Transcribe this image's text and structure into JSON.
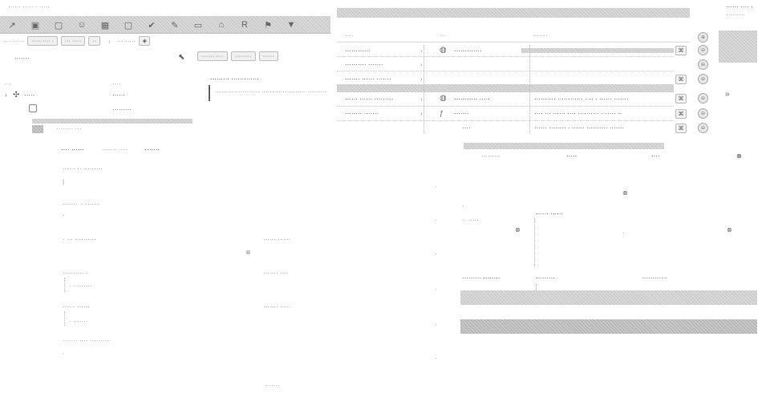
{
  "title_bar": {
    "left_caption": "······ ····· · ·····",
    "right_top": "······ ···· ·",
    "right_top2": "·········"
  },
  "toolbar": {
    "icons": [
      "arrow-icon",
      "image-icon",
      "square-icon",
      "person-icon",
      "grid-icon",
      "square2-icon",
      "check-icon",
      "pen-icon",
      "trash-icon",
      "home-icon",
      "reader-icon",
      "flag-icon",
      "help-icon"
    ]
  },
  "tabs": {
    "items": [
      "·· ·······",
      "·········· ·",
      "··· ·····",
      "··"
    ],
    "right_label": "··· ·····",
    "subtab_label": "······· ····",
    "subtab_2": "·········",
    "subtab_3": "······"
  },
  "left_tree": {
    "header": "·······",
    "col1": "···",
    "col2": "····",
    "rows": [
      {
        "name": "·····",
        "value": "······"
      },
      {
        "name": "",
        "value": "·········"
      }
    ],
    "selected": "········ ···"
  },
  "desc_panel": {
    "title": "········· ·············",
    "body": "·········· ·········· ············ ········ ·········"
  },
  "grid": {
    "headers": [
      "····",
      "···",
      "·······"
    ],
    "rows": [
      {
        "name": "············",
        "type": "·············",
        "desc": ""
      },
      {
        "name": "·········· ·······",
        "type": "",
        "desc": ""
      },
      {
        "name": "······· ······ ·······",
        "type": "",
        "desc": ""
      },
      {
        "name": "······ ······ ·········",
        "type": "··········· ·····",
        "desc": "·········· ············ ···· · ······ ·······"
      },
      {
        "name": "········ ·······",
        "type": "·······",
        "desc": "···· ··· ······ ···· ·········· ······· ··"
      },
      {
        "name": "",
        "type": "····",
        "desc": "······ ········ · ······ ·········· ·······"
      }
    ]
  },
  "form": {
    "tabs": [
      "···· ······",
      "······· ····",
      "·······"
    ],
    "labels": [
      "······ ·· ·········",
      "······· ·· ·······",
      "· ··· ··········",
      "·········· ·",
      "······ ······",
      "······· ···· ··········",
      "··········"
    ],
    "right_labels": [
      "······ ······",
      "······· ····",
      "······· ·····"
    ],
    "footer": "·······"
  },
  "diagram": {
    "header_left": "·········",
    "header_mid": "·····",
    "box_title": "······ ······",
    "bottom_labels": [
      "········· ········",
      "·········",
      "············"
    ],
    "side_letters": [
      "·",
      "·",
      "·",
      "·",
      "·",
      "·"
    ]
  }
}
